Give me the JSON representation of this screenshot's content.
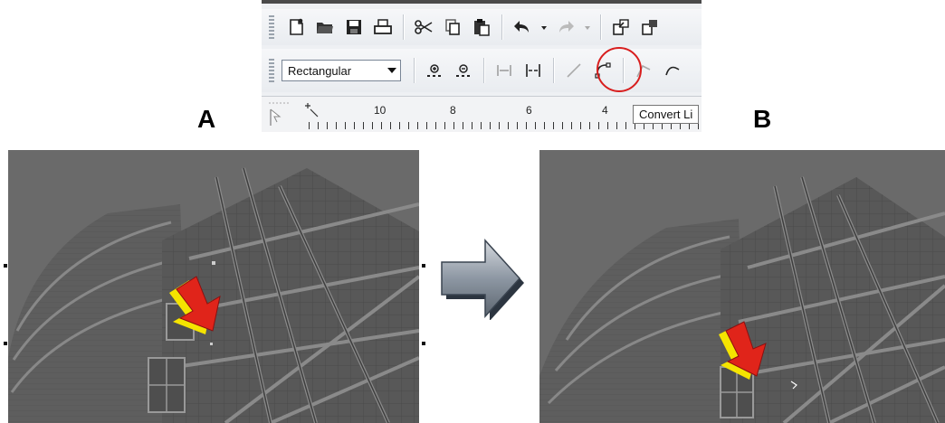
{
  "toolbar": {
    "row1_icons": [
      "new-document-icon",
      "open-folder-icon",
      "save-disk-icon",
      "print-icon",
      "cut-scissors-icon",
      "copy-icon",
      "paste-icon",
      "undo-icon",
      "redo-icon",
      "import-icon",
      "export-icon"
    ],
    "mode_select": {
      "value": "Rectangular"
    },
    "row2_icons": [
      "add-node-icon",
      "delete-node-icon",
      "join-nodes-icon",
      "break-curve-icon",
      "convert-to-line-icon",
      "convert-to-curve-icon",
      "cusp-node-icon",
      "smooth-node-icon"
    ],
    "tooltip": "Convert Li",
    "ruler_numbers": [
      "10",
      "8",
      "6",
      "4"
    ]
  },
  "labels": {
    "a": "A",
    "b": "B"
  },
  "colors": {
    "highlight": "#d81e1e",
    "arrow_fill": "#e0241a",
    "arrow_shadow": "#f5e400",
    "transition_arrow": "#7d8794"
  }
}
